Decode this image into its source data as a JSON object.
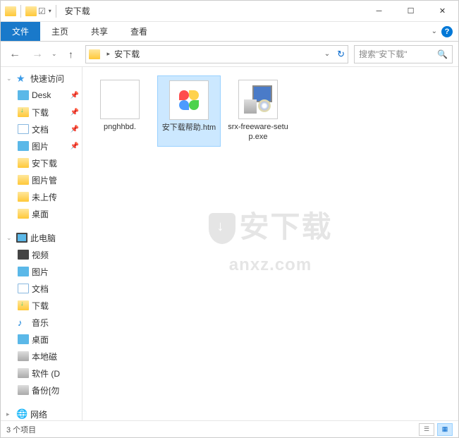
{
  "window": {
    "title": "安下载"
  },
  "ribbon": {
    "file": "文件",
    "tabs": [
      "主页",
      "共享",
      "查看"
    ]
  },
  "address": {
    "path": "安下载"
  },
  "search": {
    "placeholder": "搜索\"安下载\""
  },
  "sidebar": {
    "quick_access": "快速访问",
    "quick_items": [
      {
        "label": "Desk",
        "type": "desk",
        "pinned": true
      },
      {
        "label": "下载",
        "type": "dl",
        "pinned": true
      },
      {
        "label": "文档",
        "type": "doc",
        "pinned": true
      },
      {
        "label": "图片",
        "type": "pic",
        "pinned": true
      },
      {
        "label": "安下载",
        "type": "folder",
        "pinned": false
      },
      {
        "label": "图片管",
        "type": "folder",
        "pinned": false
      },
      {
        "label": "未上传",
        "type": "folder",
        "pinned": false
      },
      {
        "label": "桌面",
        "type": "folder",
        "pinned": false
      }
    ],
    "this_pc": "此电脑",
    "pc_items": [
      {
        "label": "视频",
        "type": "video"
      },
      {
        "label": "图片",
        "type": "pic"
      },
      {
        "label": "文档",
        "type": "doc"
      },
      {
        "label": "下载",
        "type": "dl"
      },
      {
        "label": "音乐",
        "type": "music"
      },
      {
        "label": "桌面",
        "type": "desk"
      },
      {
        "label": "本地磁",
        "type": "disk"
      },
      {
        "label": "软件 (D",
        "type": "disk"
      },
      {
        "label": "备份[勿",
        "type": "disk"
      }
    ],
    "network": "网络"
  },
  "files": [
    {
      "name": "pnghhbd.",
      "type": "blank"
    },
    {
      "name": "安下载帮助.htm",
      "type": "htm",
      "selected": true
    },
    {
      "name": "srx-freeware-setup.exe",
      "type": "exe"
    }
  ],
  "statusbar": {
    "count": "3 个项目"
  },
  "watermark": {
    "line1": "安下载",
    "line2": "anxz.com"
  }
}
